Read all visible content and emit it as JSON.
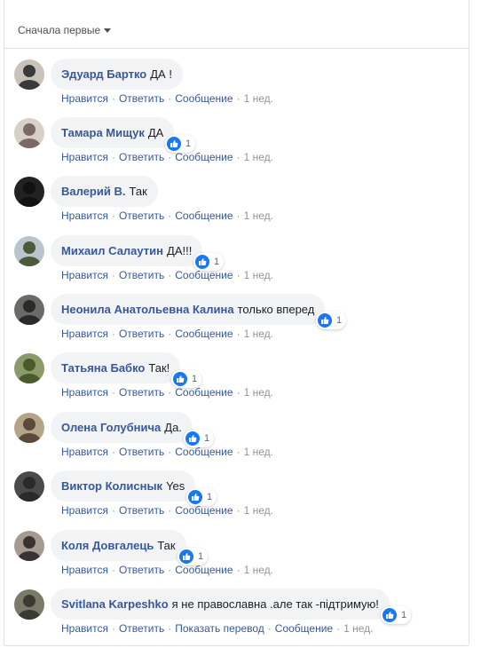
{
  "sort": {
    "label": "Сначала первые"
  },
  "actions": {
    "like": "Нравится",
    "reply": "Ответить",
    "message": "Сообщение",
    "translate": "Показать перевод",
    "time": "1 нед."
  },
  "comments": [
    {
      "author": "Эдуард Бартко",
      "text": "ДА !",
      "likes": ""
    },
    {
      "author": "Тамара Мищук",
      "text": "ДА",
      "likes": "1"
    },
    {
      "author": "Валерий В.",
      "text": "Так",
      "likes": ""
    },
    {
      "author": "Михаил Салаутин",
      "text": "ДА!!!",
      "likes": "1"
    },
    {
      "author": "Неонила Анатольевна Калина",
      "text": "только вперед",
      "likes": "1"
    },
    {
      "author": "Татьяна Бабко",
      "text": "Так!",
      "likes": "1"
    },
    {
      "author": "Олена Голубнича",
      "text": "Да.",
      "likes": "1"
    },
    {
      "author": "Виктор Колиснык",
      "text": "Yes",
      "likes": "1"
    },
    {
      "author": "Коля Довгалець",
      "text": "Так",
      "likes": "1"
    },
    {
      "author": "Svitlana Karpeshko",
      "text": "я не православна .але так -підтримую!",
      "likes": "1"
    }
  ],
  "colors": {
    "link": "#385898",
    "bubble": "#f2f3f5",
    "like_blue": "#1877f2",
    "meta_gray": "#90949c"
  }
}
